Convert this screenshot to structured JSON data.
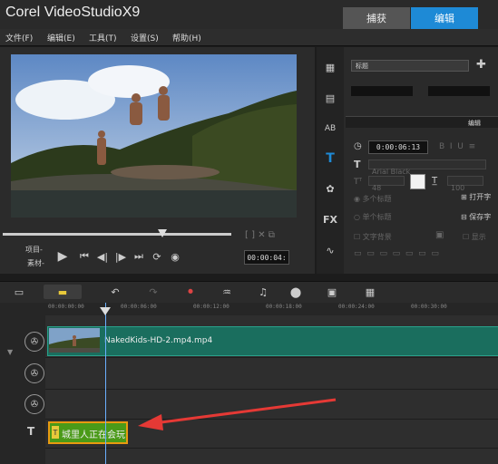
{
  "app": {
    "brand": "Corel",
    "product": "VideoStudio",
    "version": "X9"
  },
  "tabs": [
    {
      "label": "捕获"
    },
    {
      "label": "编辑"
    }
  ],
  "menu": [
    {
      "label": "文件(F)"
    },
    {
      "label": "编辑(E)"
    },
    {
      "label": "工具(T)"
    },
    {
      "label": "设置(S)"
    },
    {
      "label": "帮助(H)"
    }
  ],
  "preview": {
    "mode_project": "项目-",
    "mode_clip": "素材-",
    "timecode": "00:00:04:",
    "progress": 0.7
  },
  "options": {
    "preset_select": "标题",
    "edit_label": "编辑",
    "duration": "0:00:06:13",
    "font_name": "Arial Black",
    "font_size": "48",
    "line_spacing": "100",
    "multi_title": "多个标题",
    "single_title": "单个标题",
    "text_background": "文字背景",
    "open_label": "打开字",
    "save_label": "保存字",
    "display_label": "显示"
  },
  "ruler": [
    "00:00:00:00",
    "00:00:06:00",
    "00:00:12:00",
    "00:00:18:00",
    "00:00:24:00",
    "00:00:30:00"
  ],
  "timeline": {
    "video_clip_name": "NakedKids-HD-2.mp4.mp4",
    "title_clip_text": "城里人正在会玩"
  },
  "colors": {
    "accent": "#1e8ad6",
    "title_clip": "#4a9a18",
    "video_clip": "#1a6e5e",
    "arrow": "#e53935"
  }
}
